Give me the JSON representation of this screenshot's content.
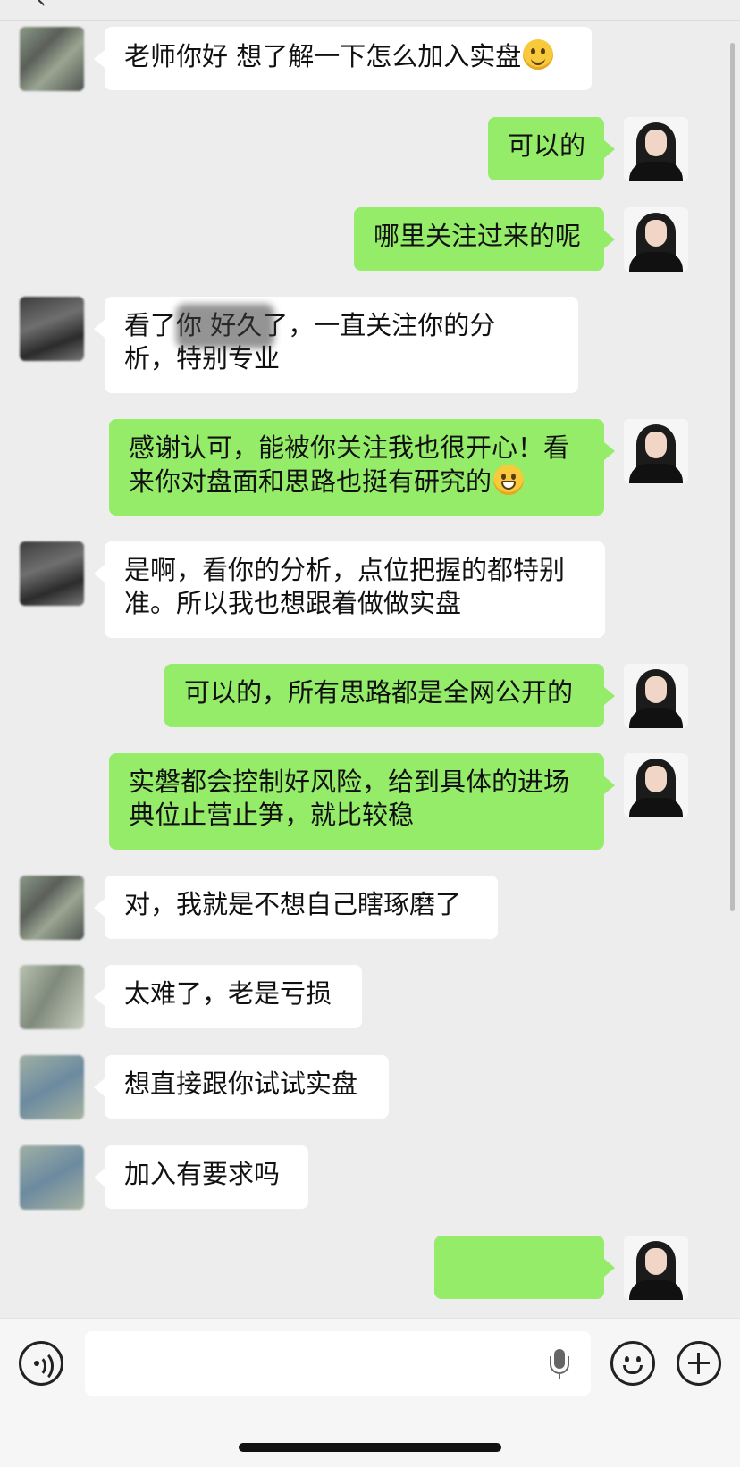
{
  "header": {
    "title": "",
    "back_icon": "chevron-left-icon"
  },
  "messages": [
    {
      "side": "in",
      "text": "老师你好 想了解一下怎么加入实盘",
      "emoji": "smile"
    },
    {
      "side": "out",
      "text": "可以的"
    },
    {
      "side": "out",
      "text": "哪里关注过来的呢"
    },
    {
      "side": "in",
      "lines": [
        "看了你 好久了，一直关注你的分",
        "析，特别专业"
      ],
      "redacted": true
    },
    {
      "side": "out",
      "lines": [
        "感谢认可，能被你关注我也很开心！看",
        "来你对盘面和思路也挺有研究的"
      ],
      "emoji": "grin"
    },
    {
      "side": "in",
      "lines": [
        "是啊，看你的分析，点位把握的都特别",
        "准。所以我也想跟着做做实盘"
      ]
    },
    {
      "side": "out",
      "text": "可以的，所有思路都是全网公开的"
    },
    {
      "side": "out",
      "lines": [
        "实磐都会控制好风险，给到具体的进场",
        "典位止营止笋，就比较稳"
      ]
    },
    {
      "side": "in",
      "text": "对，我就是不想自己瞎琢磨了"
    },
    {
      "side": "in",
      "text": "太难了，老是亏损"
    },
    {
      "side": "in",
      "text": "想直接跟你试试实盘"
    },
    {
      "side": "in",
      "text": "加入有要求吗"
    },
    {
      "side": "out",
      "text": ""
    }
  ],
  "input_bar": {
    "voice_icon": "voice-icon",
    "text_value": "",
    "mic_icon": "microphone-icon",
    "emoji_icon": "emoji-icon",
    "plus_icon": "plus-icon"
  },
  "colors": {
    "background": "#ededed",
    "incoming": "#ffffff",
    "outgoing": "#95ec69"
  }
}
